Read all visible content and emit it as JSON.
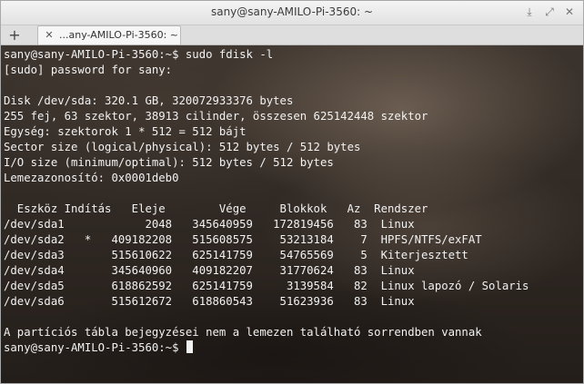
{
  "window": {
    "title": "sany@sany-AMILO-Pi-3560: ~",
    "controls": {
      "minimize_icon": "⤓",
      "maximize_icon": "⤢",
      "close_icon": "✕"
    }
  },
  "tabbar": {
    "new_tab_icon": "+",
    "tabs": [
      {
        "label": "...any-AMILO-Pi-3560: ~",
        "close_icon": "✕"
      }
    ]
  },
  "terminal": {
    "lines": [
      "sany@sany-AMILO-Pi-3560:~$ sudo fdisk -l",
      "[sudo] password for sany:",
      "",
      "Disk /dev/sda: 320.1 GB, 320072933376 bytes",
      "255 fej, 63 szektor, 38913 cilinder, összesen 625142448 szektor",
      "Egység: szektorok 1 * 512 = 512 bájt",
      "Sector size (logical/physical): 512 bytes / 512 bytes",
      "I/O size (minimum/optimal): 512 bytes / 512 bytes",
      "Lemezazonosító: 0x0001deb0",
      "",
      "  Eszköz Indítás   Eleje        Vége     Blokkok   Az  Rendszer",
      "/dev/sda1            2048   345640959   172819456   83  Linux",
      "/dev/sda2   *   409182208   515608575    53213184    7  HPFS/NTFS/exFAT",
      "/dev/sda3       515610622   625141759    54765569    5  Kiterjesztett",
      "/dev/sda4       345640960   409182207    31770624   83  Linux",
      "/dev/sda5       618862592   625141759     3139584   82  Linux lapozó / Solaris",
      "/dev/sda6       515612672   618860543    51623936   83  Linux",
      "",
      "A partíciós tábla bejegyzései nem a lemezen található sorrendben vannak",
      "sany@sany-AMILO-Pi-3560:~$ "
    ]
  }
}
